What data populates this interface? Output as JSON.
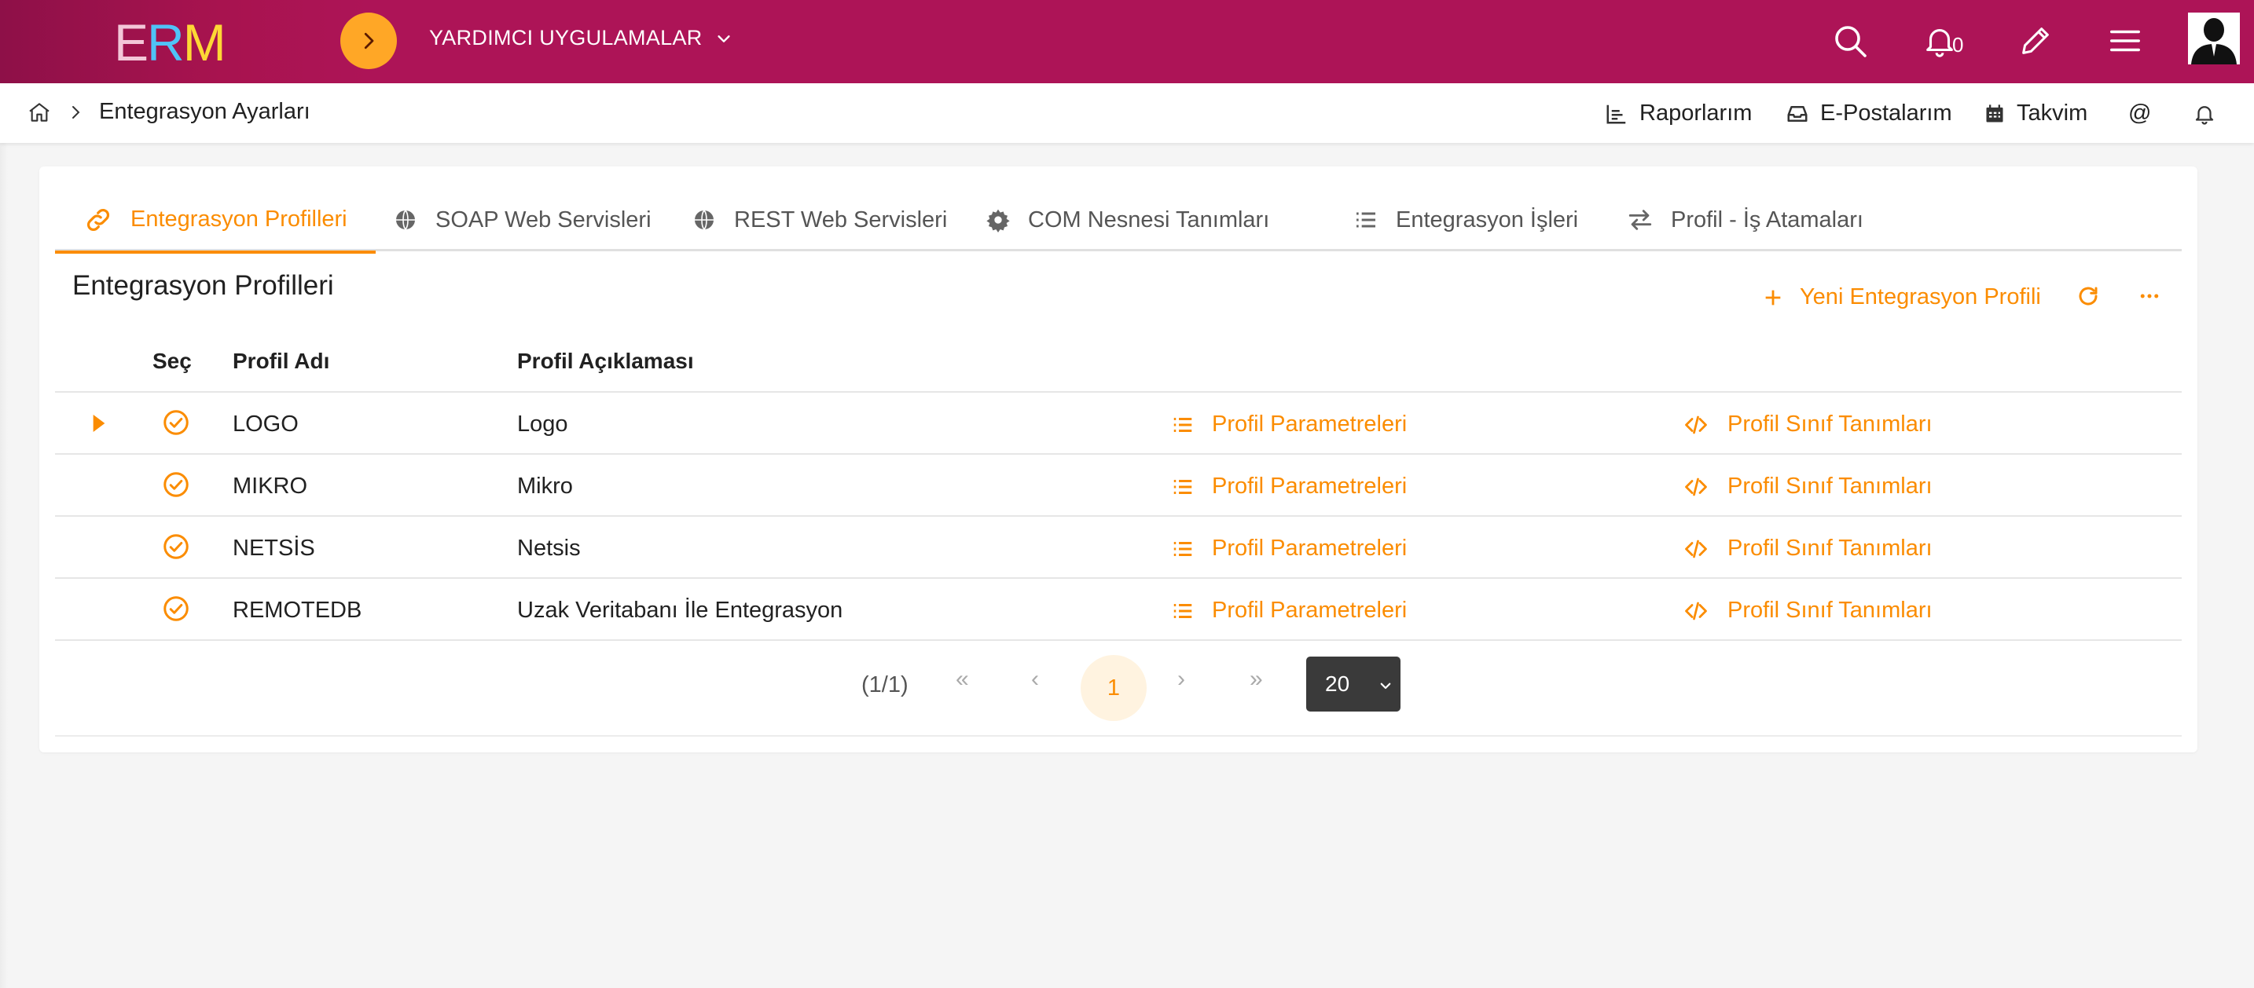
{
  "topbar": {
    "logo": {
      "e": "E",
      "r": "R",
      "m": "M"
    },
    "app_menu_label": "YARDIMCI UYGULAMALAR",
    "notification_count": "0",
    "brand_color": "#ad1457",
    "accent_color": "#ffa726"
  },
  "breadcrumb": {
    "page": "Entegrasyon Ayarları"
  },
  "quick_links": {
    "reports": "Raporlarım",
    "emails": "E-Postalarım",
    "calendar": "Takvim",
    "at": "@"
  },
  "tabs": [
    {
      "label": "Entegrasyon Profilleri",
      "icon": "link-icon",
      "active": true
    },
    {
      "label": "SOAP Web Servisleri",
      "icon": "globe-icon"
    },
    {
      "label": "REST Web Servisleri",
      "icon": "globe-icon"
    },
    {
      "label": "COM Nesnesi Tanımları",
      "icon": "gear-icon"
    },
    {
      "label": "Entegrasyon İşleri",
      "icon": "list-icon"
    },
    {
      "label": "Profil - İş Atamaları",
      "icon": "swap-icon"
    }
  ],
  "section": {
    "title": "Entegrasyon Profilleri",
    "new_button": "Yeni Entegrasyon Profili"
  },
  "table": {
    "headers": {
      "select": "Seç",
      "name": "Profil Adı",
      "description": "Profil Açıklaması"
    },
    "rows": [
      {
        "name": "LOGO",
        "description": "Logo",
        "params": "Profil Parametreleri",
        "classes": "Profil Sınıf Tanımları"
      },
      {
        "name": "MIKRO",
        "description": "Mikro",
        "params": "Profil Parametreleri",
        "classes": "Profil Sınıf Tanımları"
      },
      {
        "name": "NETSİS",
        "description": "Netsis",
        "params": "Profil Parametreleri",
        "classes": "Profil Sınıf Tanımları"
      },
      {
        "name": "REMOTEDB",
        "description": "Uzak Veritabanı İle Entegrasyon",
        "params": "Profil Parametreleri",
        "classes": "Profil Sınıf Tanımları"
      }
    ]
  },
  "pager": {
    "summary": "(1/1)",
    "first": "«",
    "prev": "‹",
    "current": "1",
    "next": "›",
    "last": "»",
    "page_size": "20"
  }
}
